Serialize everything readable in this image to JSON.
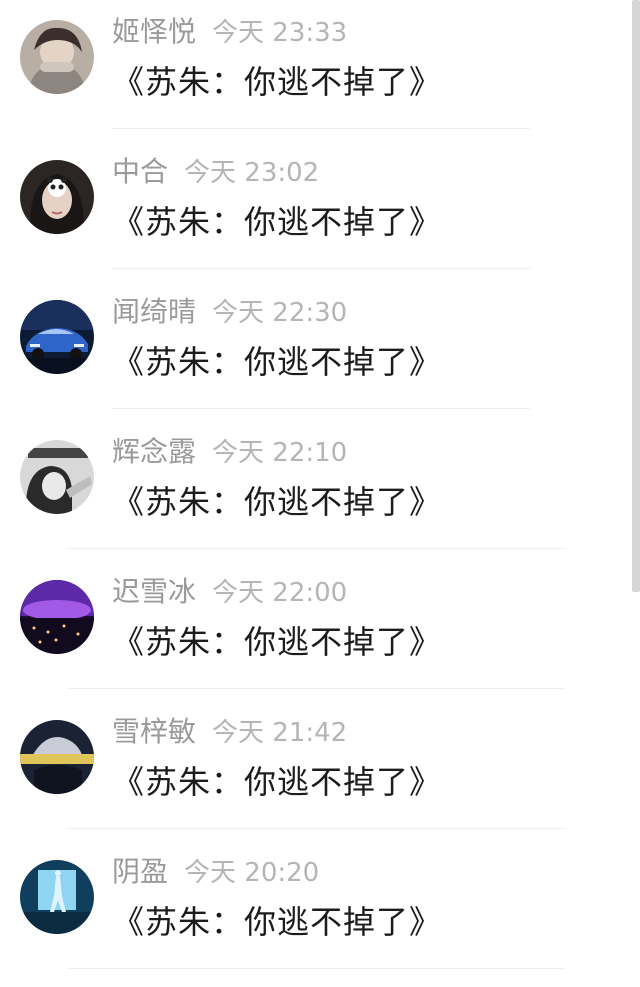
{
  "comments": [
    {
      "avatar": "avatar-girl-scarf",
      "name": "姬怿悦",
      "time": "今天 23:33",
      "text": "《苏朱：你逃不掉了》"
    },
    {
      "avatar": "avatar-girl-sticker",
      "name": "中合",
      "time": "今天 23:02",
      "text": "《苏朱：你逃不掉了》"
    },
    {
      "avatar": "avatar-blue-car",
      "name": "闻绮晴",
      "time": "今天 22:30",
      "text": "《苏朱：你逃不掉了》"
    },
    {
      "avatar": "avatar-bw-portrait",
      "name": "辉念露",
      "time": "今天 22:10",
      "text": "《苏朱：你逃不掉了》"
    },
    {
      "avatar": "avatar-purple-city",
      "name": "迟雪冰",
      "time": "今天 22:00",
      "text": "《苏朱：你逃不掉了》"
    },
    {
      "avatar": "avatar-dark-figure",
      "name": "雪梓敏",
      "time": "今天 21:42",
      "text": "《苏朱：你逃不掉了》"
    },
    {
      "avatar": "avatar-cyan-figure",
      "name": "阴盈",
      "time": "今天 20:20",
      "text": "《苏朱：你逃不掉了》"
    }
  ],
  "colors": {
    "name": "#9a9a9a",
    "time": "#b5b5b5",
    "comment": "#1c1c1c",
    "divider": "#eeeeee",
    "scrollbar": "#d6d6d6"
  }
}
